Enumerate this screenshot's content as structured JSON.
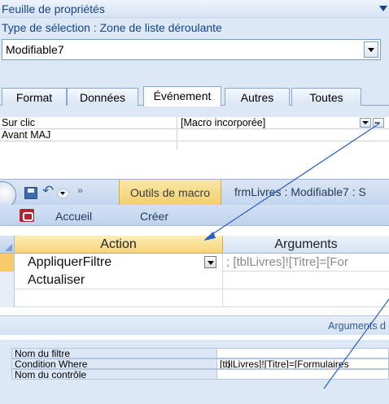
{
  "property_sheet": {
    "title": "Feuille de propriétés",
    "selection_type": "Type de sélection :  Zone de liste déroulante",
    "control_name": "Modifiable7",
    "tabs": [
      {
        "label": "Format"
      },
      {
        "label": "Données"
      },
      {
        "label": "Événement",
        "active": true
      },
      {
        "label": "Autres"
      },
      {
        "label": "Toutes"
      }
    ],
    "properties": [
      {
        "name": "Sur clic",
        "value": "[Macro incorporée]"
      },
      {
        "name": "Avant MAJ",
        "value": ""
      }
    ],
    "build_button_label": "..."
  },
  "window": {
    "qat_more": "»",
    "contextual_tab": "Outils de macro",
    "title": "frmLivres : Modifiable7 : S",
    "ribbon_tabs": [
      {
        "label": "Accueil"
      },
      {
        "label": "Créer"
      }
    ]
  },
  "macro_grid": {
    "headers": {
      "action": "Action",
      "arguments": "Arguments"
    },
    "rows": [
      {
        "action": "AppliquerFiltre",
        "arguments": "; [tblLivres]![Titre]=[For",
        "current": true
      },
      {
        "action": "Actualiser",
        "arguments": ""
      },
      {
        "action": "",
        "arguments": ""
      }
    ]
  },
  "arguments_panel": {
    "title": "Arguments d",
    "rows": [
      {
        "name": "Nom du filtre",
        "value": ""
      },
      {
        "name": "Condition Where",
        "value": "[tblLivres]![Titre]=[Formulaires"
      },
      {
        "name": "Nom du contrôle",
        "value": ""
      }
    ]
  },
  "colors": {
    "sheet_bg": "#dde8f6",
    "title_text": "#15428b",
    "contextual_tab": "#f3cf6b",
    "action_header": "#f7d37a",
    "current_row_selector": "#f6c96b",
    "annotation_arrow": "#2a5fc4"
  },
  "icons": [
    "dropdown-arrow-icon",
    "build-button-icon",
    "office-orb-icon",
    "save-icon",
    "undo-icon",
    "customize-qat-icon",
    "access-app-icon"
  ]
}
